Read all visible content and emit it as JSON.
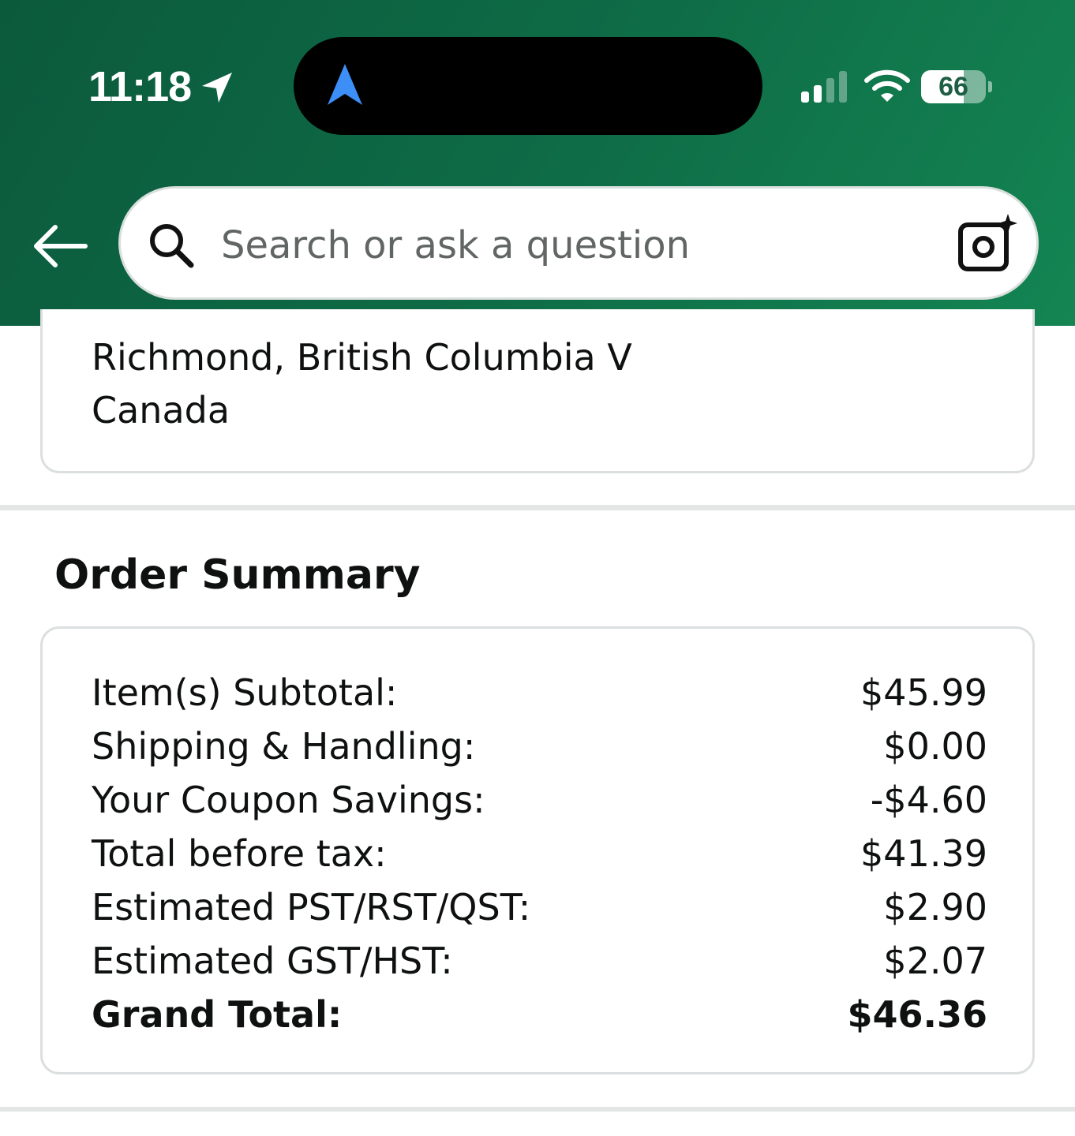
{
  "status_bar": {
    "time": "11:18",
    "battery_percent": "66",
    "battery_level": 0.66,
    "cellular_bars_active": 2,
    "cellular_bars_total": 4
  },
  "search": {
    "placeholder": "Search or ask a question"
  },
  "address": {
    "line1": "Richmond, British Columbia V",
    "line2": "Canada"
  },
  "order_summary": {
    "title": "Order Summary",
    "rows": [
      {
        "label": "Item(s) Subtotal:",
        "value": "$45.99"
      },
      {
        "label": "Shipping & Handling:",
        "value": "$0.00"
      },
      {
        "label": "Your Coupon Savings:",
        "value": "-$4.60"
      },
      {
        "label": "Total before tax:",
        "value": "$41.39"
      },
      {
        "label": "Estimated PST/RST/QST:",
        "value": "$2.90"
      },
      {
        "label": "Estimated GST/HST:",
        "value": "$2.07"
      },
      {
        "label": "Grand Total:",
        "value": "$46.36"
      }
    ]
  },
  "colors": {
    "header_dark": "#0b5a3c",
    "header_light": "#148553",
    "nav_arrow_blue": "#3d8ef7"
  },
  "icons": [
    "location-arrow-icon",
    "navigation-icon",
    "cellular-signal-icon",
    "wifi-icon",
    "battery-icon",
    "back-arrow-icon",
    "search-icon",
    "camera-sparkle-icon"
  ]
}
